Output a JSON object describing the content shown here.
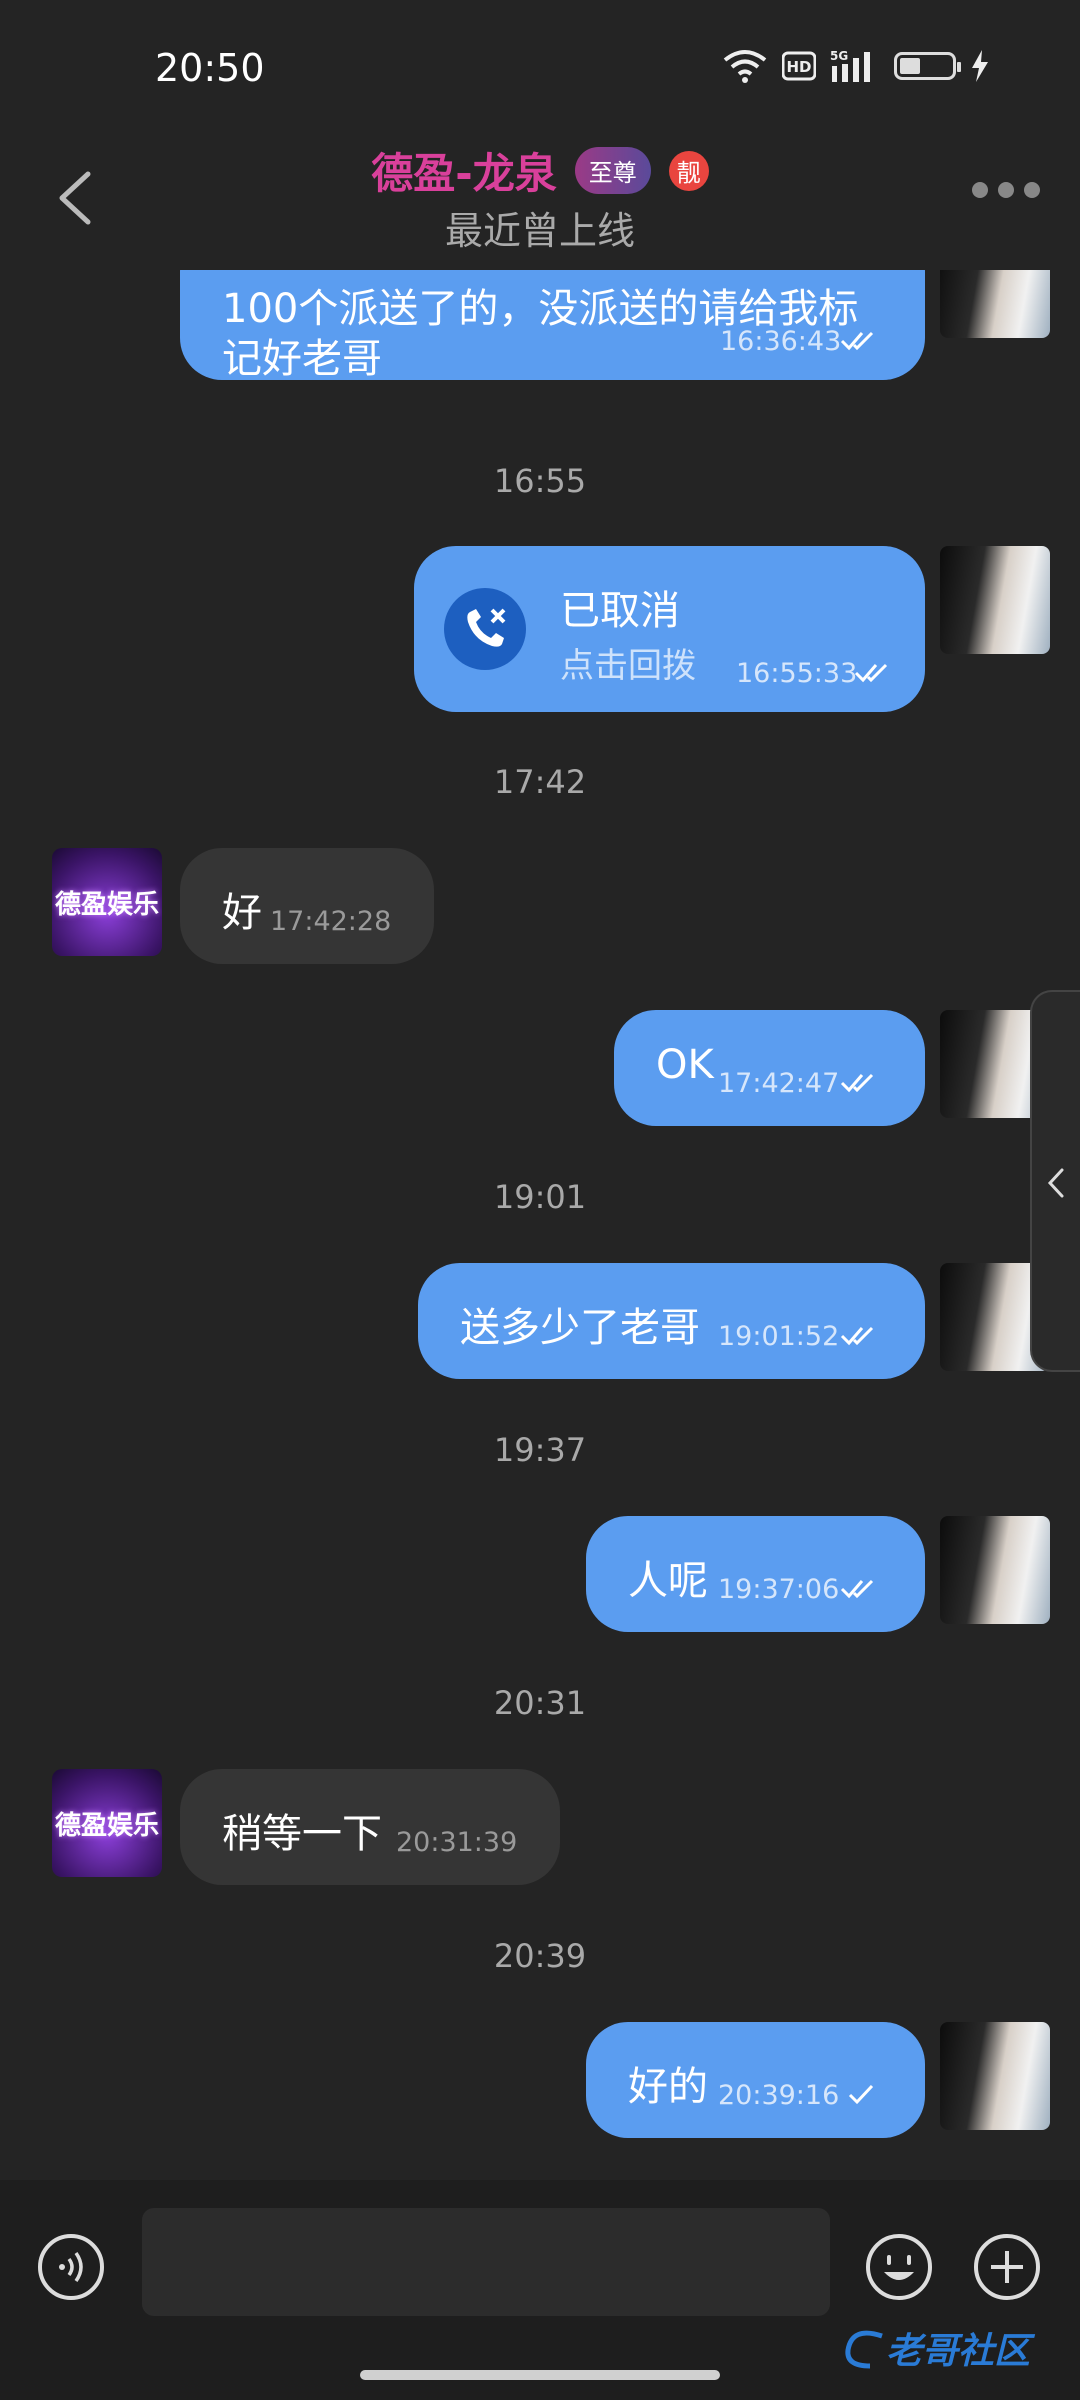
{
  "status_bar": {
    "time": "20:50",
    "hd_label": "HD",
    "network_label": "5G"
  },
  "header": {
    "title": "德盈-龙泉",
    "vip_badge": "至尊",
    "liang_badge": "靓",
    "subtitle": "最近曾上线"
  },
  "brand_avatar_text": "德盈娱乐",
  "messages": [
    {
      "text_line1": "100个派送了的，没派送的请给我标",
      "text_line2": "记好老哥",
      "time": "16:36:43"
    },
    {
      "separator": "16:55"
    },
    {
      "call_title": "已取消",
      "call_sub": "点击回拨",
      "time": "16:55:33"
    },
    {
      "separator": "17:42"
    },
    {
      "text": "好",
      "time": "17:42:28"
    },
    {
      "text": "OK",
      "time": "17:42:47"
    },
    {
      "separator": "19:01"
    },
    {
      "text": "送多少了老哥",
      "time": "19:01:52"
    },
    {
      "separator": "19:37"
    },
    {
      "text": "人呢",
      "time": "19:37:06"
    },
    {
      "separator": "20:31"
    },
    {
      "text": "稍等一下",
      "time": "20:31:39"
    },
    {
      "separator": "20:39"
    },
    {
      "text": "好的",
      "time": "20:39:16"
    }
  ],
  "input": {
    "placeholder": ""
  },
  "watermark": "老哥社区",
  "colors": {
    "outgoing_bubble": "#5b9df0",
    "incoming_bubble": "#353535",
    "background": "#242424",
    "title": "#d9409b"
  }
}
